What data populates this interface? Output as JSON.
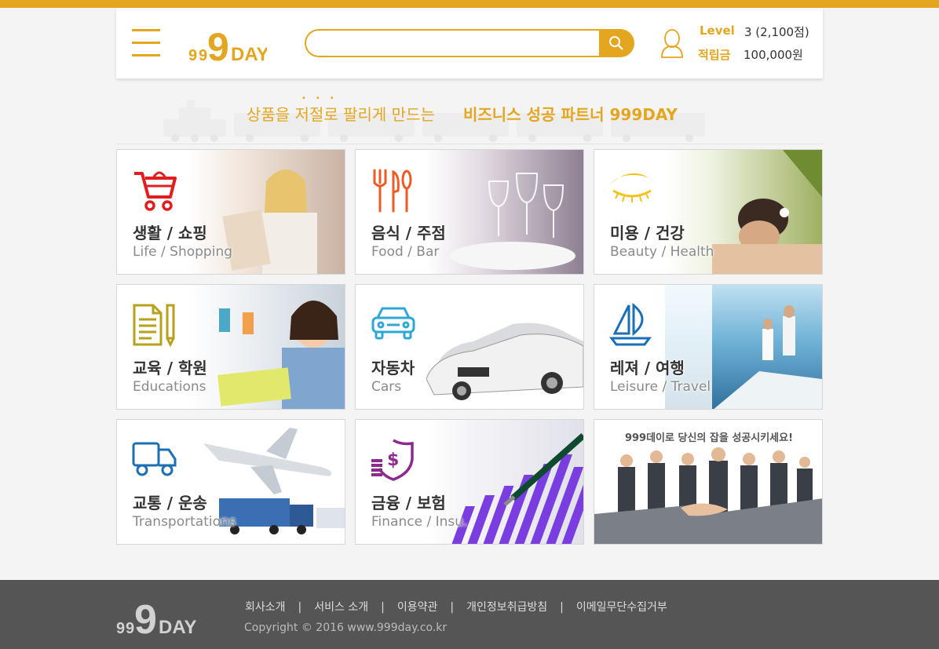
{
  "brand": {
    "name": "999DAY",
    "accent": "#e4a51f"
  },
  "search": {
    "value": "",
    "placeholder": ""
  },
  "account": {
    "level_label": "Level",
    "level_value": "3 (2,100점)",
    "points_label": "적립금",
    "points_value": "100,000원"
  },
  "banner": {
    "text_main": "상품을 저절로 팔리게 만드는",
    "text_bold": "비즈니스 성공 파트너  999DAY"
  },
  "categories": [
    {
      "kr": "생활 / 쇼핑",
      "en": "Life / Shopping",
      "icon": "shopping-cart-icon"
    },
    {
      "kr": "음식 / 주점",
      "en": "Food / Bar",
      "icon": "fork-knife-icon"
    },
    {
      "kr": "미용 / 건강",
      "en": "Beauty / Health",
      "icon": "eye-lash-icon"
    },
    {
      "kr": "교육 / 학원",
      "en": "Educations",
      "icon": "document-pencil-icon"
    },
    {
      "kr": "자동차",
      "en": "Cars",
      "icon": "car-icon"
    },
    {
      "kr": "레져 / 여행",
      "en": "Leisure / Travel",
      "icon": "sailboat-icon"
    },
    {
      "kr": "교통 / 운송",
      "en": "Transportations",
      "icon": "truck-icon"
    },
    {
      "kr": "금융 / 보험",
      "en": "Finance / Insu.",
      "icon": "money-shield-icon"
    }
  ],
  "promo": {
    "text": "999데이로 당신의 잡을 성공시키세요!"
  },
  "footer": {
    "links": [
      "회사소개",
      "서비스 소개",
      "이용약관",
      "개인정보취급방침",
      "이메일무단수집거부"
    ],
    "separator": "|",
    "copyright": "Copyright © 2016 www.999day.co.kr"
  }
}
